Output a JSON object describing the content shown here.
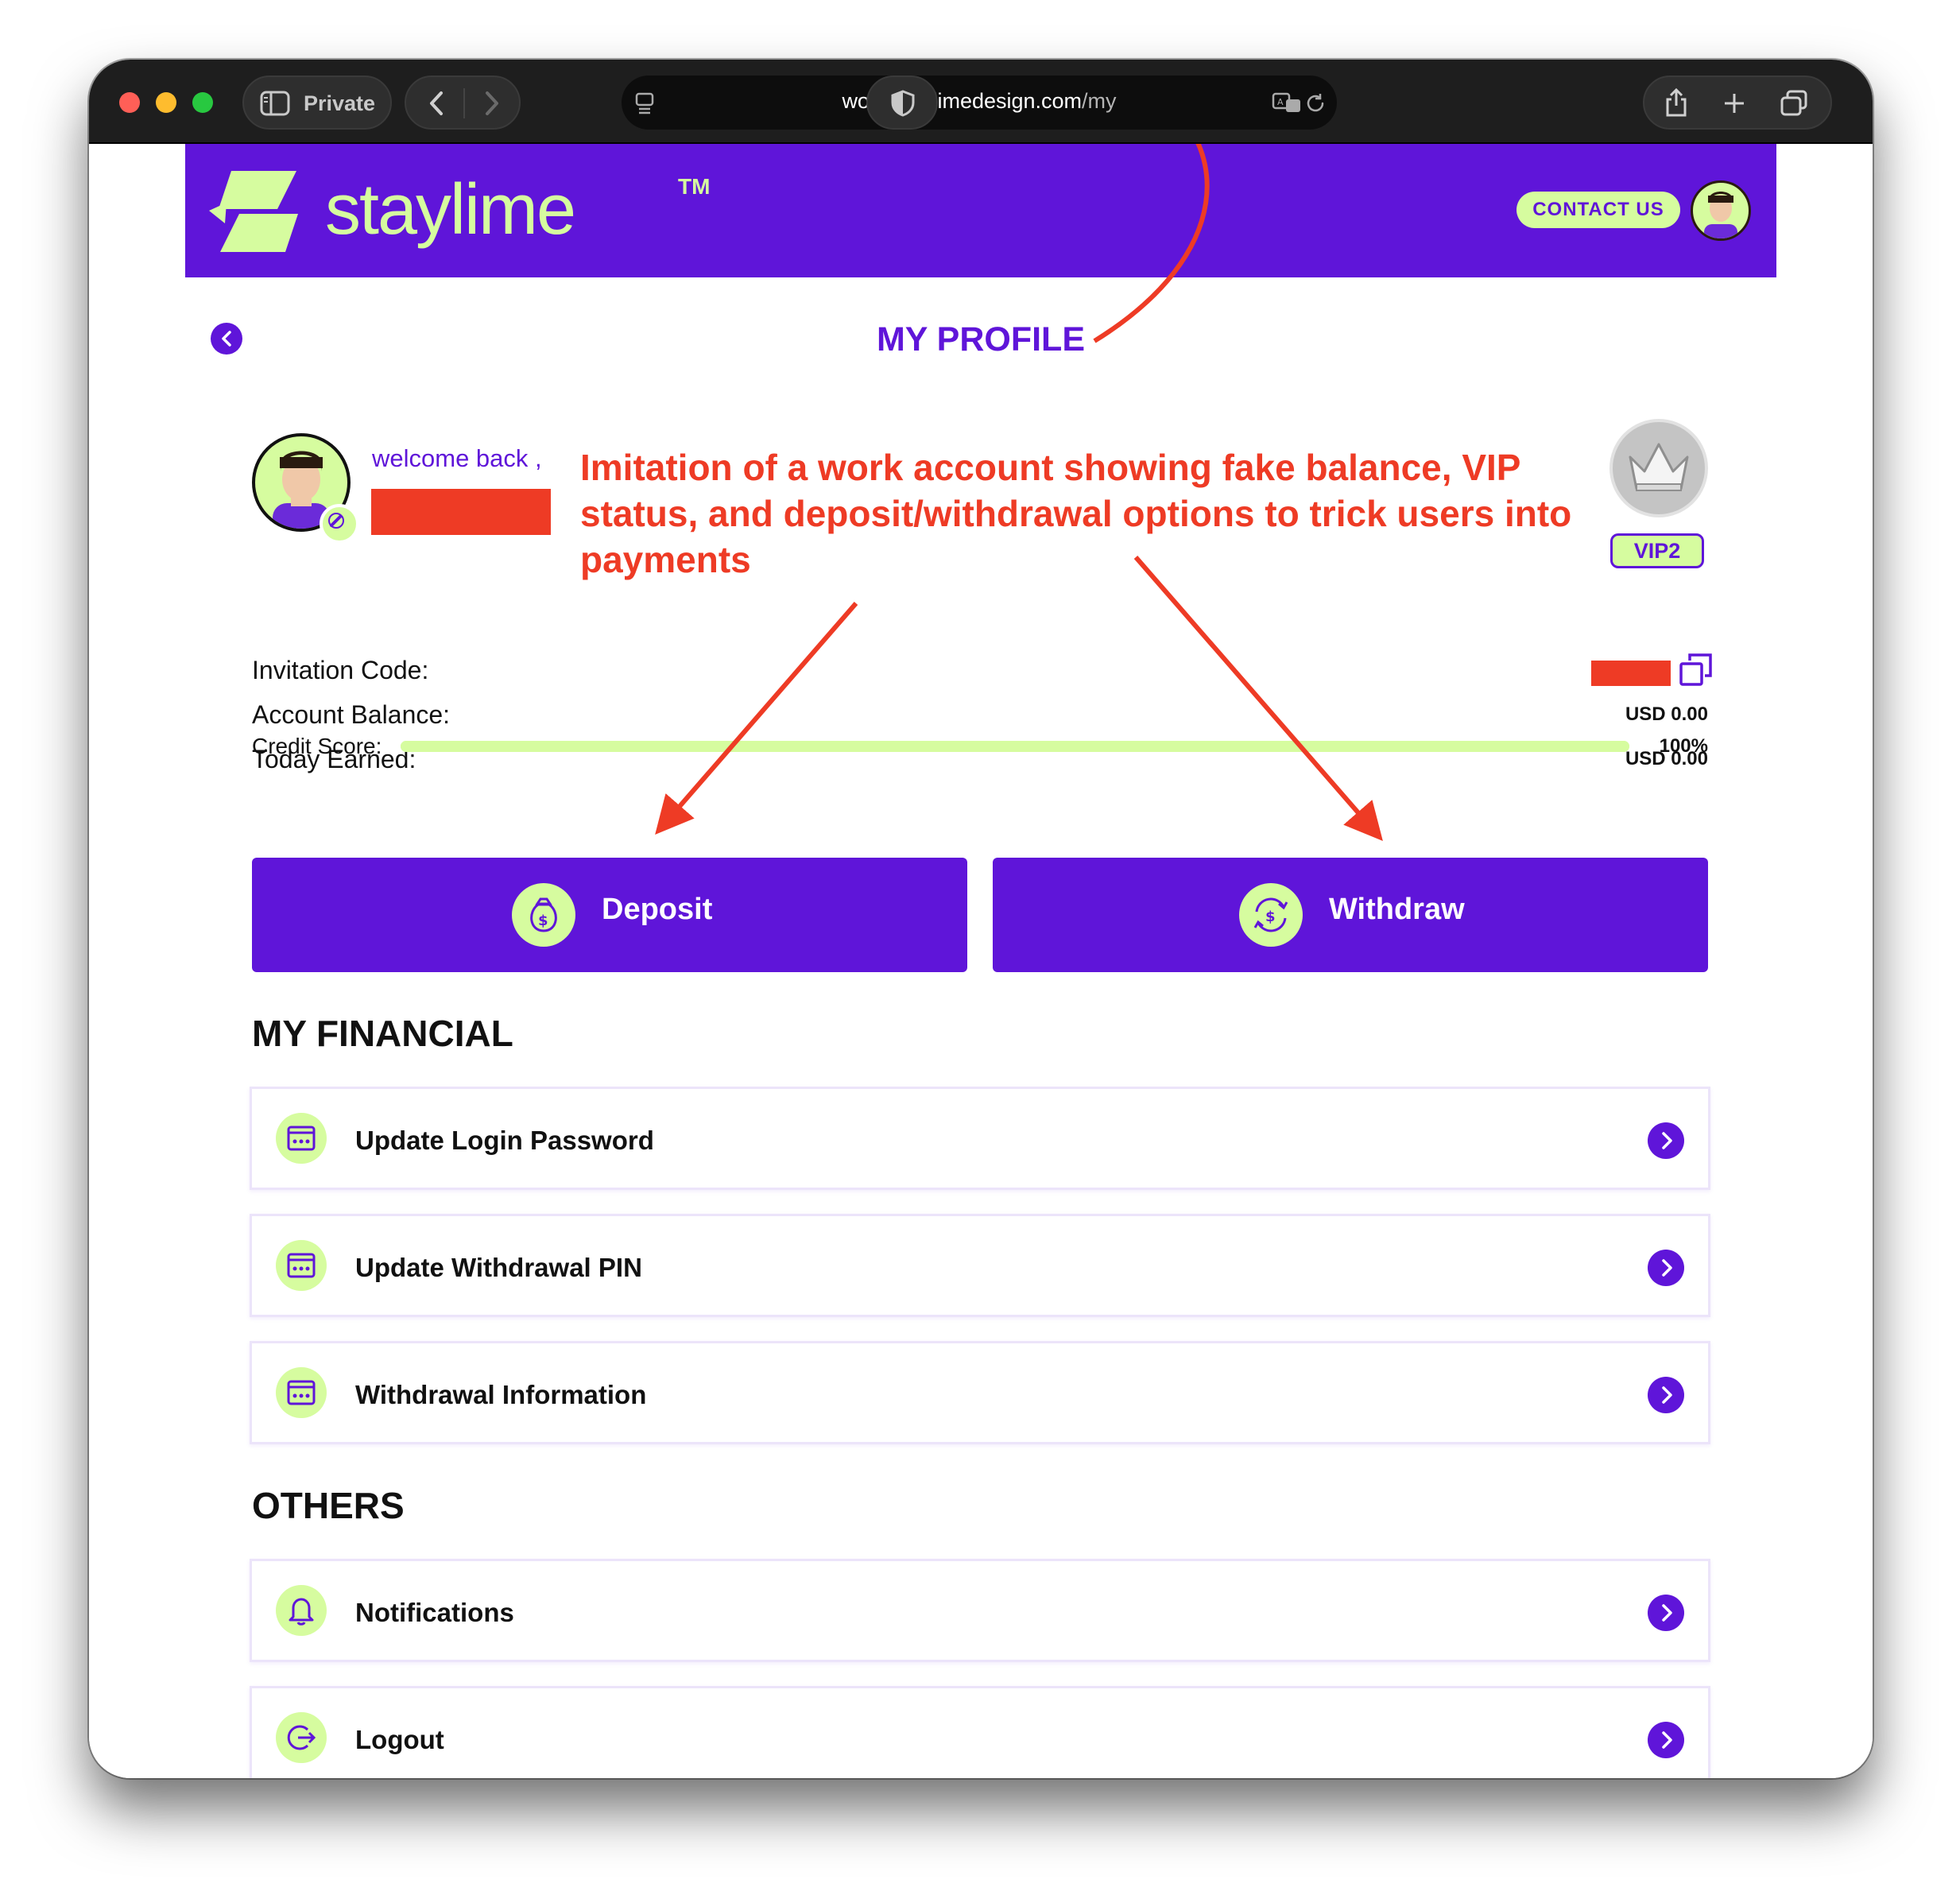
{
  "browser": {
    "private_label": "Private",
    "url_host": "work.staylimedesign.com",
    "url_path": "/my"
  },
  "header": {
    "brand": "staylime",
    "trademark": "TM",
    "contact_label": "CONTACT US"
  },
  "page": {
    "title": "MY PROFILE"
  },
  "profile": {
    "welcome": "welcome back ,",
    "vip_label": "VIP2",
    "invitation_code_label": "Invitation Code:",
    "account_balance_label": "Account Balance:",
    "account_balance_value": "USD 0.00",
    "today_earned_label": "Today Earned:",
    "today_earned_value": "USD 0.00",
    "credit_score_label": "Credit Score:",
    "credit_score_value": "100%",
    "credit_score_fraction": 1.0
  },
  "actions": {
    "deposit_label": "Deposit",
    "withdraw_label": "Withdraw"
  },
  "financial": {
    "heading": "MY FINANCIAL",
    "items": [
      {
        "label": "Update Login Password",
        "icon": "password-icon"
      },
      {
        "label": "Update Withdrawal PIN",
        "icon": "password-icon"
      },
      {
        "label": "Withdrawal Information",
        "icon": "password-icon"
      }
    ]
  },
  "others": {
    "heading": "OTHERS",
    "items": [
      {
        "label": "Notifications",
        "icon": "bell-icon"
      },
      {
        "label": "Logout",
        "icon": "logout-icon"
      }
    ]
  },
  "annotation": {
    "text": "Imitation of a work account showing fake balance, VIP status, and deposit/withdrawal options to trick users into payments"
  },
  "colors": {
    "brand_purple": "#5f15d9",
    "brand_lime": "#d6fc9f",
    "annotation_red": "#ee3b25"
  }
}
